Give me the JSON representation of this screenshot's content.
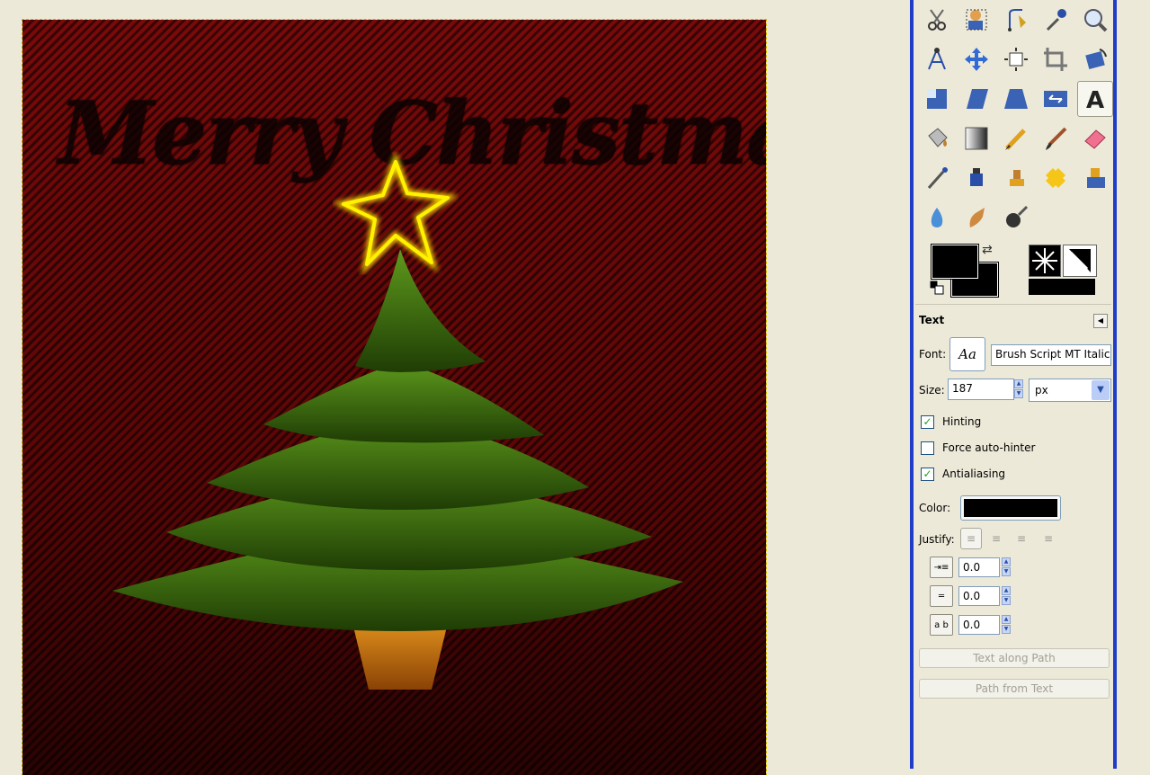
{
  "canvas": {
    "text": "Merry Christmas",
    "colors": {
      "background": "#7a0a0a",
      "tree": "#3e6b10",
      "pot": "#c8700e",
      "star": "#ffe000"
    }
  },
  "toolbox": {
    "tools": [
      {
        "name": "scissors-select-icon"
      },
      {
        "name": "foreground-select-icon"
      },
      {
        "name": "paths-icon"
      },
      {
        "name": "color-picker-icon"
      },
      {
        "name": "zoom-icon"
      },
      {
        "name": "measure-icon"
      },
      {
        "name": "move-icon"
      },
      {
        "name": "align-icon"
      },
      {
        "name": "crop-icon"
      },
      {
        "name": "rotate-icon"
      },
      {
        "name": "scale-icon"
      },
      {
        "name": "shear-icon"
      },
      {
        "name": "perspective-icon"
      },
      {
        "name": "flip-icon"
      },
      {
        "name": "text-tool-icon",
        "active": true
      },
      {
        "name": "bucket-fill-icon"
      },
      {
        "name": "blend-icon"
      },
      {
        "name": "pencil-icon"
      },
      {
        "name": "paintbrush-icon"
      },
      {
        "name": "eraser-icon"
      },
      {
        "name": "airbrush-icon"
      },
      {
        "name": "ink-icon"
      },
      {
        "name": "clone-icon"
      },
      {
        "name": "heal-icon"
      },
      {
        "name": "perspective-clone-icon"
      },
      {
        "name": "blur-icon"
      },
      {
        "name": "smudge-icon"
      },
      {
        "name": "dodge-burn-icon"
      }
    ],
    "foreground_color": "#000000",
    "background_color": "#000000"
  },
  "tool_options": {
    "title": "Text",
    "font_label": "Font:",
    "font_button": "Aa",
    "font_value": "Brush Script MT Italic",
    "size_label": "Size:",
    "size_value": "187",
    "size_unit": "px",
    "hinting_label": "Hinting",
    "hinting_checked": true,
    "force_autohinter_label": "Force auto-hinter",
    "force_autohinter_checked": false,
    "antialiasing_label": "Antialiasing",
    "antialiasing_checked": true,
    "color_label": "Color:",
    "color_value": "#000000",
    "justify_label": "Justify:",
    "indent_value": "0.0",
    "line_spacing_value": "0.0",
    "letter_spacing_value": "0.0",
    "text_along_path_label": "Text along Path",
    "path_from_text_label": "Path from Text"
  }
}
